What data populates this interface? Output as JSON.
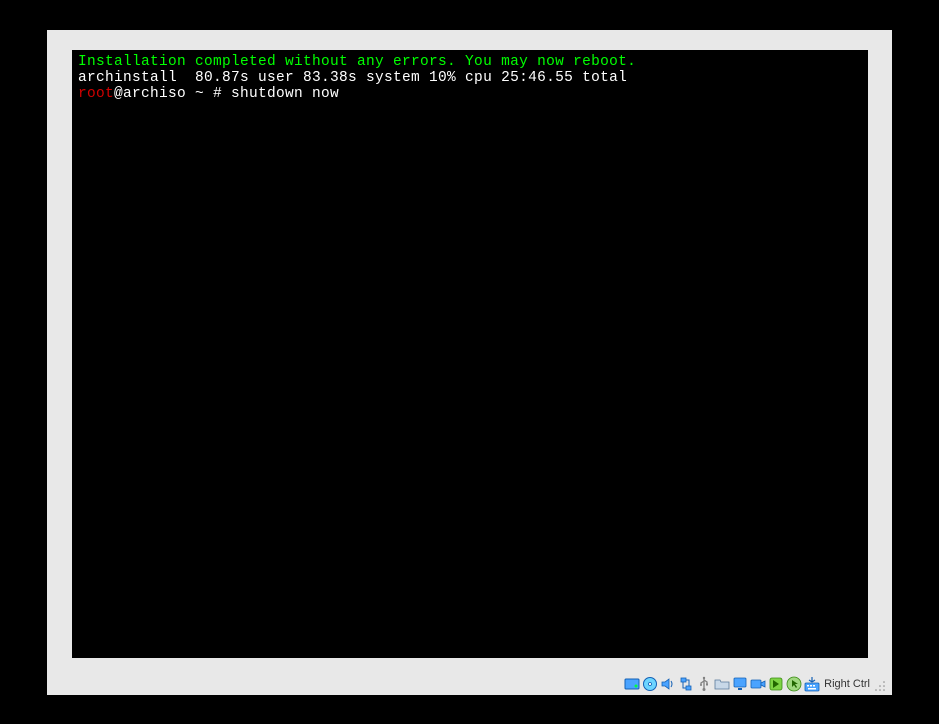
{
  "terminal": {
    "line1": "Installation completed without any errors. You may now reboot.",
    "line2": "archinstall  80.87s user 83.38s system 10% cpu 25:46.55 total",
    "prompt_user": "root",
    "prompt_host": "@archiso ~ # ",
    "command": "shutdown now"
  },
  "statusbar": {
    "host_key_label": "Right Ctrl"
  }
}
